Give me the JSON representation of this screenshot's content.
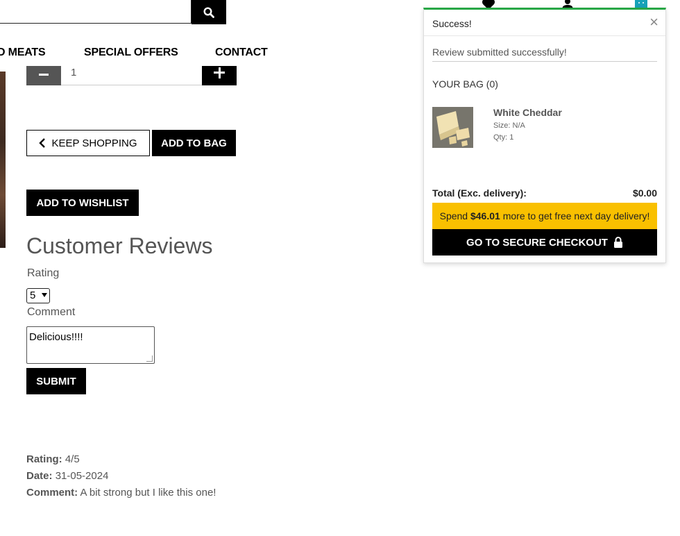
{
  "nav": {
    "items": [
      "D MEATS",
      "SPECIAL OFFERS",
      "CONTACT"
    ]
  },
  "product": {
    "quantity": "1"
  },
  "actions": {
    "keep_shopping": "KEEP SHOPPING",
    "add_to_bag": "ADD TO BAG",
    "add_to_wishlist": "ADD TO WISHLIST"
  },
  "reviews": {
    "title": "Customer Reviews",
    "rating_label": "Rating",
    "rating_value": "5",
    "comment_label": "Comment",
    "comment_value": "Delicious!!!!",
    "submit": "SUBMIT",
    "existing": {
      "rating_label": "Rating:",
      "rating_value": "4/5",
      "date_label": "Date:",
      "date_value": "31-05-2024",
      "comment_label": "Comment:",
      "comment_value": "A bit strong but I like this one!"
    }
  },
  "toast": {
    "header": "Success!",
    "close": "×",
    "message": "Review submitted successfully!",
    "bag_title": "YOUR BAG (0)",
    "item": {
      "name": "White Cheddar",
      "size": "Size: N/A",
      "qty": "Qty: 1"
    },
    "total_label": "Total (Exc. delivery):",
    "total_value": "$0.00",
    "delivery_prefix": "Spend ",
    "delivery_amount": "$46.01",
    "delivery_suffix": " more to get free next day delivery!",
    "checkout": "GO TO SECURE CHECKOUT"
  },
  "colors": {
    "accent_success": "#28a745",
    "delivery_banner": "#f9c000",
    "cart_icon": "#17a2b8"
  }
}
